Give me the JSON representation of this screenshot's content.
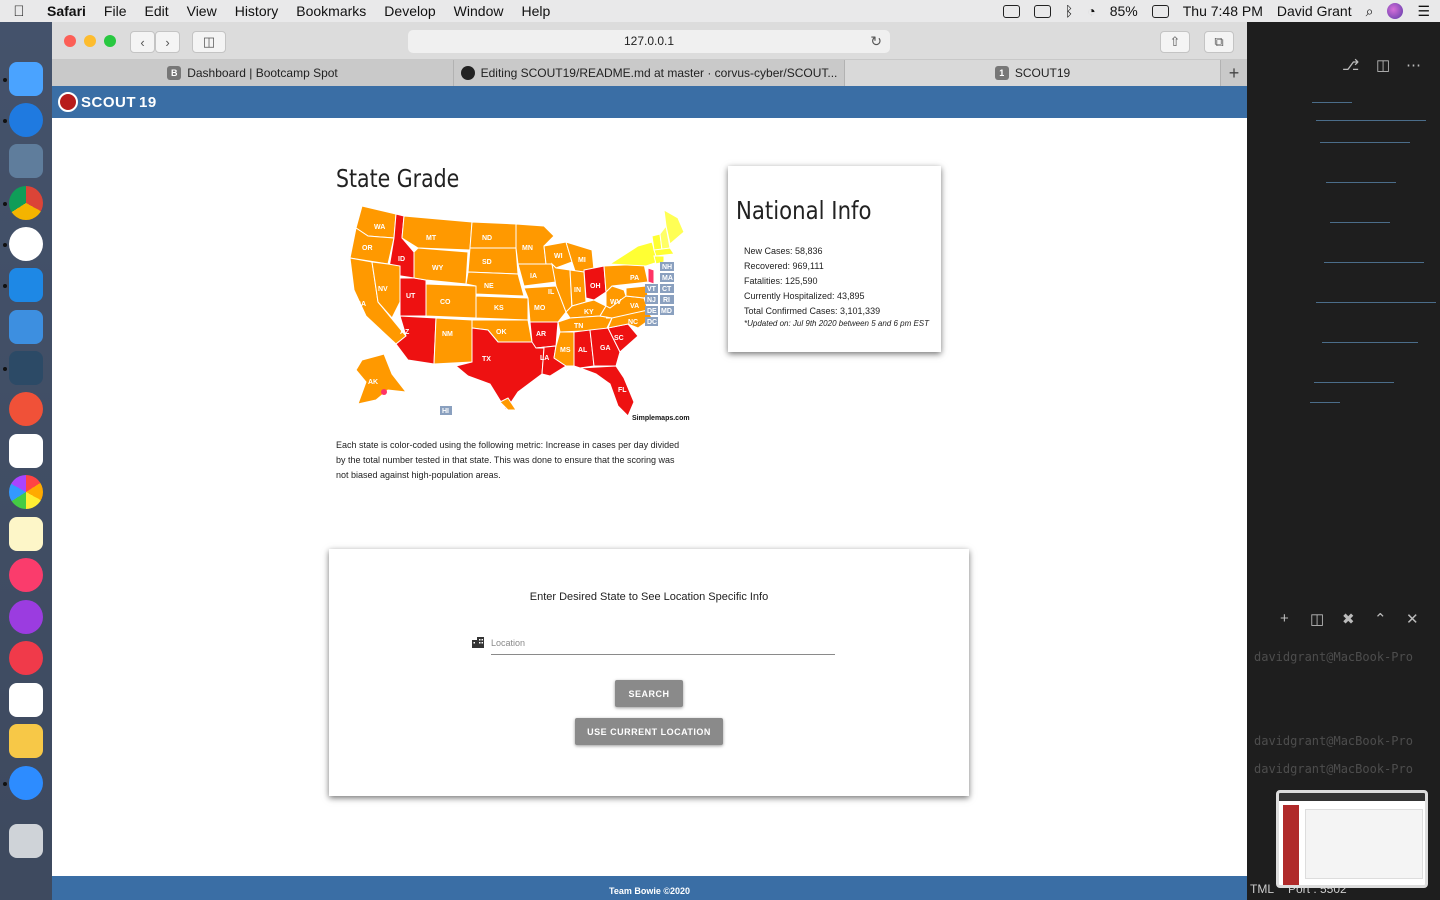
{
  "menubar": {
    "app": "Safari",
    "items": [
      "File",
      "Edit",
      "View",
      "History",
      "Bookmarks",
      "Develop",
      "Window",
      "Help"
    ],
    "battery": "85%",
    "clock": "Thu 7:48 PM",
    "user": "David Grant"
  },
  "browser": {
    "address": "127.0.0.1",
    "tabs": [
      {
        "label": "Dashboard | Bootcamp Spot",
        "favicon": "B"
      },
      {
        "label": "Editing SCOUT19/README.md at master · corvus-cyber/SCOUT...",
        "favicon": "github-icon"
      },
      {
        "label": "SCOUT19",
        "favicon": "1"
      }
    ]
  },
  "site": {
    "brand": "SCOUT",
    "brand_num": "19",
    "state_grade_title": "State Grade",
    "map_credit": "Simplemaps.com",
    "map_description": "Each state is color-coded using the following metric: Increase in cases per day divided by the total number tested in that state. This was done to ensure that the scoring was not biased against high-population areas.",
    "national": {
      "title": "National Info",
      "stats": [
        "New Cases: 58,836",
        "Recovered: 969,111",
        "Fatalities: 125,590",
        "Currently Hospitalized: 43,895",
        "Total Confirmed Cases: 3,101,339"
      ],
      "updated": "*Updated on: Jul 9th 2020 between 5 and 6 pm EST"
    },
    "search": {
      "prompt": "Enter Desired State to See Location Specific Info",
      "location_placeholder": "Location",
      "search_label": "SEARCH",
      "geo_label": "USE CURRENT LOCATION"
    },
    "footer": "Team Bowie ©2020"
  },
  "editor": {
    "terminal_lines": [
      "davidgrant@MacBook-Pro",
      "davidgrant@MacBook-Pro",
      "davidgrant@MacBook-Pro"
    ],
    "status_left": "TML",
    "status_port": "Port : 5502"
  },
  "colors": {
    "nav": "#3a6ea5",
    "grade_orange": "#ff9900",
    "grade_red": "#ee1111",
    "grade_yellow": "#ffff33",
    "button_gray": "#8a8a8a"
  }
}
